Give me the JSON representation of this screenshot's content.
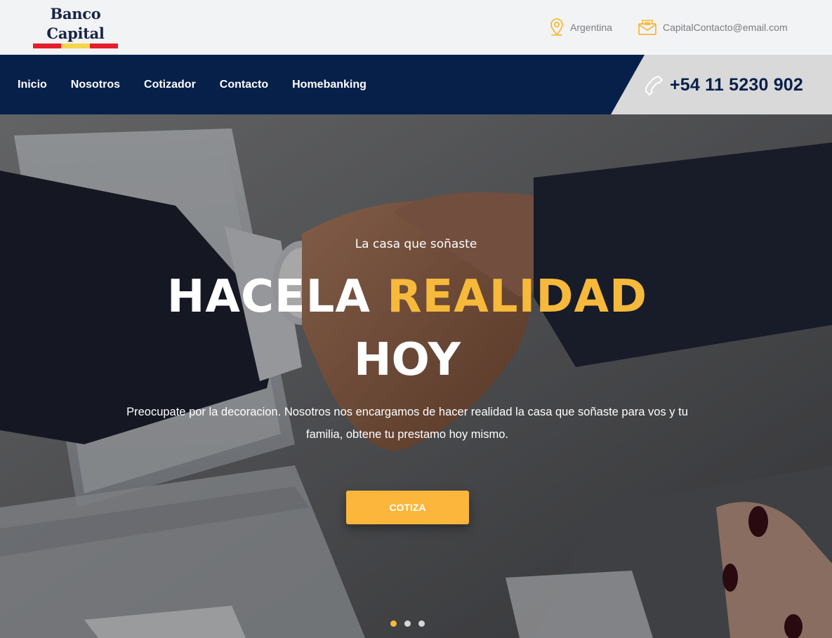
{
  "brand": {
    "line1": "Banco",
    "line2": "Capital"
  },
  "topbar": {
    "country": "Argentina",
    "email": "CapitalContacto@email.com",
    "country_icon": "location-pin-icon",
    "email_icon": "envelope-icon"
  },
  "nav": {
    "items": [
      {
        "label": "Inicio"
      },
      {
        "label": "Nosotros"
      },
      {
        "label": "Cotizador"
      },
      {
        "label": "Contacto"
      },
      {
        "label": "Homebanking"
      }
    ],
    "phone": "+54 11 5230 902",
    "phone_icon": "phone-icon"
  },
  "hero": {
    "subtitle": "La casa que soñaste",
    "title_part1": "HACELA",
    "title_accent": "REALIDAD",
    "title_line2": "HOY",
    "description": "Preocupate por la decoracion. Nosotros nos encargamos de hacer realidad la casa que soñaste para vos y tu familia, obtene tu prestamo hoy mismo.",
    "cta_label": "COTIZA",
    "slides_total": 3,
    "active_slide": 1
  },
  "colors": {
    "navy": "#06204a",
    "accent": "#f6b93b",
    "button": "#fbb63b",
    "topbar_bg": "#f2f3f5",
    "phone_panel": "#d9d9d9"
  }
}
